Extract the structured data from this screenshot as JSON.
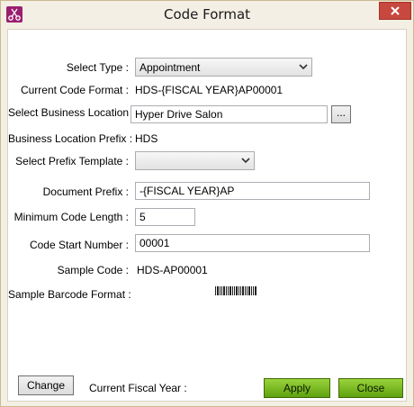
{
  "window": {
    "title": "Code Format"
  },
  "form": {
    "select_type_label": "Select Type :",
    "select_type_value": "Appointment",
    "current_code_format_label": "Current Code Format :",
    "current_code_format_value": "HDS-{FISCAL YEAR}AP00001",
    "business_location_label": "Select Business Location :",
    "business_location_value": "Hyper Drive Salon",
    "browse_label": "...",
    "location_prefix_label": "Business Location Prefix :",
    "location_prefix_value": "HDS",
    "prefix_template_label": "Select Prefix Template  :",
    "prefix_template_value": "",
    "document_prefix_label": "Document Prefix :",
    "document_prefix_value": "-{FISCAL YEAR}AP",
    "min_code_length_label": "Minimum Code Length :",
    "min_code_length_value": "5",
    "code_start_number_label": "Code Start Number :",
    "code_start_number_value": "00001",
    "sample_code_label": "Sample Code :",
    "sample_code_value": "HDS-AP00001",
    "sample_barcode_label": "Sample Barcode Format :"
  },
  "footer": {
    "change_label": "Change",
    "fiscal_year_label": "Current Fiscal Year :",
    "apply_label": "Apply",
    "close_label": "Close"
  },
  "icons": {
    "app": "scissors-icon",
    "close": "close-icon",
    "dropdown": "chevron-down-icon"
  }
}
